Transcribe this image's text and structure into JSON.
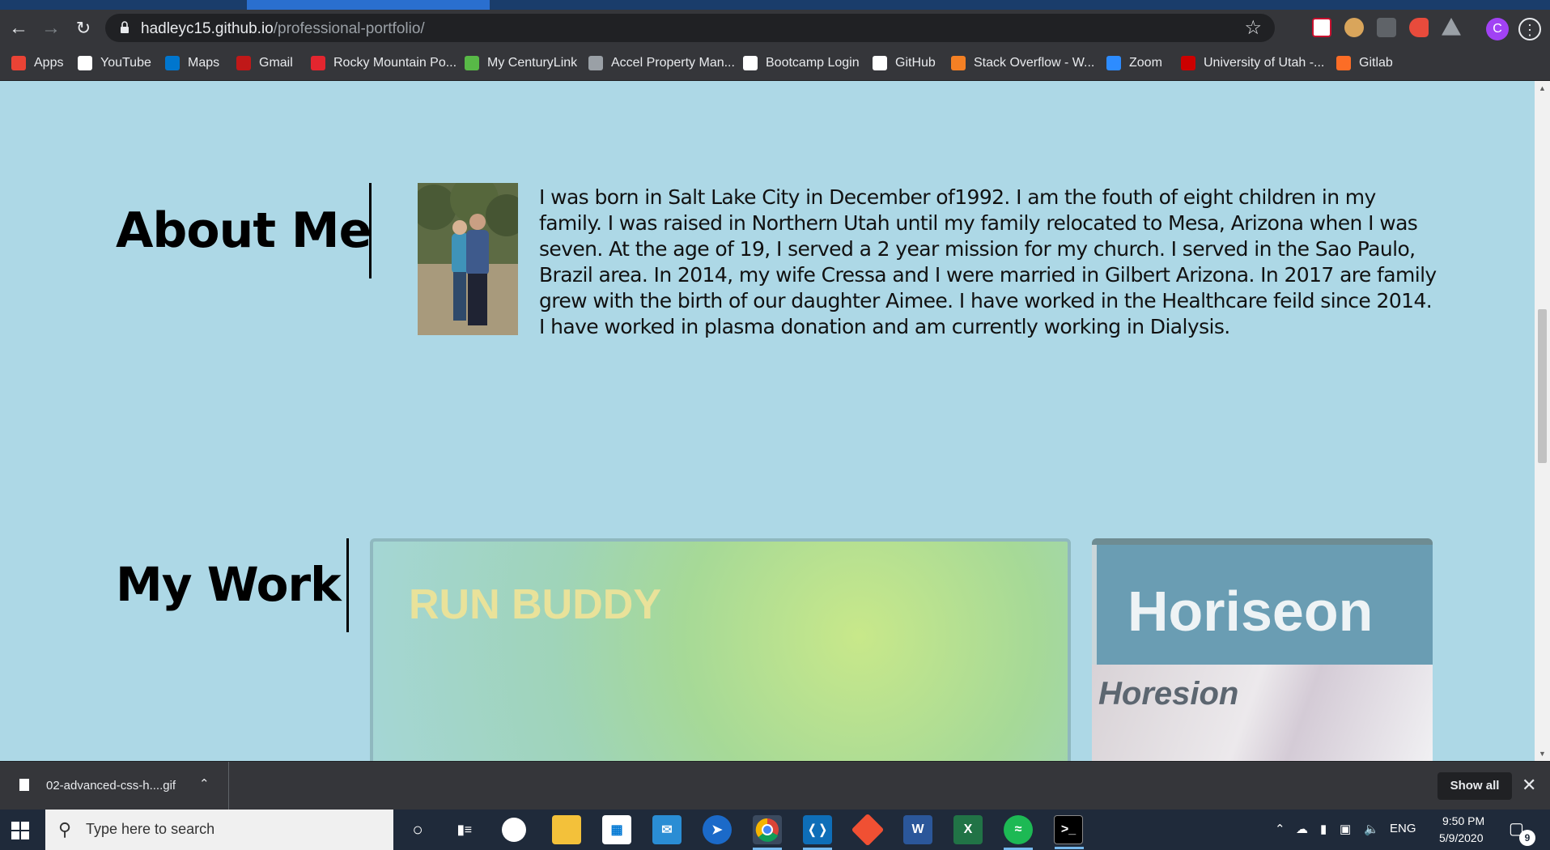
{
  "browser": {
    "url_host": "hadleyc15.github.io",
    "url_path": "/professional-portfolio/",
    "profile_initial": "C",
    "bookmarks": [
      {
        "label": "Apps",
        "icon": "apps-grid-icon",
        "color": "#ea4335"
      },
      {
        "label": "YouTube",
        "icon": "amazon-icon",
        "color": "#ffffff"
      },
      {
        "label": "Maps",
        "icon": "dell-icon",
        "color": "#0076ce"
      },
      {
        "label": "Gmail",
        "icon": "mcafee-icon",
        "color": "#c01818"
      },
      {
        "label": "Rocky Mountain Po...",
        "icon": "rocky-mountain-icon",
        "color": "#e3262f"
      },
      {
        "label": "My CenturyLink",
        "icon": "centurylink-icon",
        "color": "#58b947"
      },
      {
        "label": "Accel Property Man...",
        "icon": "building-icon",
        "color": "#9aa0a6"
      },
      {
        "label": "Bootcamp Login",
        "icon": "university-utah-icon",
        "color": "#ffffff"
      },
      {
        "label": "GitHub",
        "icon": "github-icon",
        "color": "#ffffff"
      },
      {
        "label": "Stack Overflow - W...",
        "icon": "stack-overflow-icon",
        "color": "#f48024"
      },
      {
        "label": "Zoom",
        "icon": "zoom-icon",
        "color": "#2d8cff"
      },
      {
        "label": "University of Utah -...",
        "icon": "utah-grid-icon",
        "color": "#cc0000"
      },
      {
        "label": "Gitlab",
        "icon": "gitlab-icon",
        "color": "#fc6d26"
      }
    ]
  },
  "page": {
    "about": {
      "heading": "About Me",
      "text": "I was born in Salt Lake City in December of1992. I am the fouth of eight children in my family. I was raised in Northern Utah until my family relocated to Mesa, Arizona when I was seven. At the age of 19, I served a 2 year mission for my church. I served in the Sao Paulo, Brazil area. In 2014, my wife Cressa and I were married in Gilbert Arizona. In 2017 are family grew with the birth of our daughter Aimee. I have worked in the Healthcare feild since 2014. I have worked in plasma donation and am currently working in Dialysis."
    },
    "work": {
      "heading": "My Work",
      "projects": [
        {
          "title": "RUN BUDDY"
        },
        {
          "title": "Horiseon",
          "subtitle": "Horesion"
        }
      ]
    },
    "background_color": "#add8e6"
  },
  "download_bar": {
    "file_name": "02-advanced-css-h....gif",
    "show_all": "Show all"
  },
  "taskbar": {
    "search_placeholder": "Type here to search",
    "language": "ENG",
    "time": "9:50 PM",
    "date": "5/9/2020",
    "notification_count": "9"
  }
}
